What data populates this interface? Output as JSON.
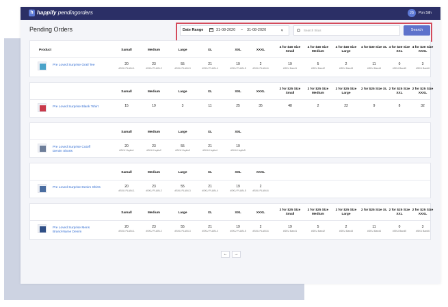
{
  "app": {
    "logo_letter": "h",
    "brand_bold": "happify",
    "brand_sub": "pendingorders"
  },
  "user": {
    "initials": "JS",
    "name": "Pon Sith"
  },
  "page_title": "Pending Orders",
  "filters": {
    "date_range_label": "Date Range",
    "date_from": "31-08-2020",
    "date_separator": "–",
    "date_to": "31-08-2020",
    "search_placeholder": "Search Skus",
    "search_button": "Search"
  },
  "products": [
    {
      "name": "Pre Loved Surprise Grail Tee",
      "thumb_color": "#4aa3c9",
      "headers": [
        "Product",
        "Samall",
        "Medium",
        "Large",
        "XL",
        "XXL",
        "XXXL",
        "4 for $40 Size Small",
        "4 for $40 Size Medium",
        "4 for $40 Size Large",
        "4 for $30 Size XL",
        "4 for $30 Size XXL",
        "4 for $30 Size XXXL"
      ],
      "cells": [
        {
          "value": "20",
          "sku": "#SKU PLAIN-1"
        },
        {
          "value": "23",
          "sku": "#SKU PLAIN-2"
        },
        {
          "value": "55",
          "sku": "#SKU PLAIN-3"
        },
        {
          "value": "21",
          "sku": "#SKU PLAIN-4"
        },
        {
          "value": "19",
          "sku": "#SKU PLAIN-5"
        },
        {
          "value": "2",
          "sku": "#SKU PLAIN-6"
        },
        {
          "value": "19",
          "sku": "#SKU Band1"
        },
        {
          "value": "5",
          "sku": "#SKU Band2"
        },
        {
          "value": "2",
          "sku": "#SKU Band3"
        },
        {
          "value": "11",
          "sku": "#SKU Band4"
        },
        {
          "value": "0",
          "sku": "#SKU Band5"
        },
        {
          "value": "3",
          "sku": "#SKU Band6"
        }
      ]
    },
    {
      "name": "Pre Loved Surprise Blank Tshirt",
      "thumb_color": "#c9394a",
      "headers": [
        "",
        "Samall",
        "Medium",
        "Large",
        "XL",
        "XXL",
        "XXXL",
        "2 for $25 Size Small",
        "2 for $25 Size Medium",
        "2 for $25 Size Large",
        "2 for $25 Size XL",
        "2 for $25 Size XXL",
        "2 for $25 Size XXXL"
      ],
      "cells": [
        {
          "value": "15",
          "sku": ""
        },
        {
          "value": "19",
          "sku": ""
        },
        {
          "value": "3",
          "sku": ""
        },
        {
          "value": "11",
          "sku": ""
        },
        {
          "value": "25",
          "sku": ""
        },
        {
          "value": "35",
          "sku": ""
        },
        {
          "value": "48",
          "sku": ""
        },
        {
          "value": "2",
          "sku": ""
        },
        {
          "value": "22",
          "sku": ""
        },
        {
          "value": "9",
          "sku": ""
        },
        {
          "value": "8",
          "sku": ""
        },
        {
          "value": "32",
          "sku": ""
        }
      ]
    },
    {
      "name": "Pre Loved Surprise Cutoff Denim Shorts",
      "thumb_color": "#6d7e99",
      "headers": [
        "",
        "Samall",
        "Medium",
        "Large",
        "XL",
        "XXL"
      ],
      "cells": [
        {
          "value": "20",
          "sku": "#SKU Hcplis1"
        },
        {
          "value": "23",
          "sku": "#SKU Hcplis2"
        },
        {
          "value": "55",
          "sku": "#SKU Hcplis3"
        },
        {
          "value": "21",
          "sku": "#SKU Hcplis4"
        },
        {
          "value": "19",
          "sku": "#SKU Hcplis5"
        }
      ]
    },
    {
      "name": "Pre Loved Surprise Denim Shirts",
      "thumb_color": "#4a6da0",
      "headers": [
        "",
        "Samall",
        "Medium",
        "Large",
        "XL",
        "XXL",
        "XXXL"
      ],
      "cells": [
        {
          "value": "20",
          "sku": "#SKU PLAIN-1"
        },
        {
          "value": "23",
          "sku": "#SKU PLAIN-2"
        },
        {
          "value": "55",
          "sku": "#SKU PLAIN-3"
        },
        {
          "value": "21",
          "sku": "#SKU PLAIN-4"
        },
        {
          "value": "19",
          "sku": "#SKU PLAIN-5"
        },
        {
          "value": "2",
          "sku": "#SKU PLAIN-6"
        }
      ]
    },
    {
      "name": "Pre Loved Surprise Mens Brand-Name Denim",
      "thumb_color": "#2f4f86",
      "headers": [
        "",
        "Samall",
        "Medium",
        "Large",
        "XL",
        "XXL",
        "XXXL",
        "2 for $25 Size Small",
        "2 for $25 Size Medium",
        "2 for $25 Size Large",
        "2 for $25 Size XL",
        "2 for $25 Size XXL",
        "2 for $25 Size XXXL"
      ],
      "cells": [
        {
          "value": "20",
          "sku": "#SKU PLAIN-1"
        },
        {
          "value": "23",
          "sku": "#SKU PLAIN-2"
        },
        {
          "value": "55",
          "sku": "#SKU PLAIN-3"
        },
        {
          "value": "21",
          "sku": "#SKU PLAIN-4"
        },
        {
          "value": "19",
          "sku": "#SKU PLAIN-5"
        },
        {
          "value": "2",
          "sku": "#SKU PLAIN-6"
        },
        {
          "value": "19",
          "sku": "#SKU Band1"
        },
        {
          "value": "5",
          "sku": "#SKU Band2"
        },
        {
          "value": "2",
          "sku": "#SKU Band3"
        },
        {
          "value": "11",
          "sku": "#SKU Band4"
        },
        {
          "value": "0",
          "sku": "#SKU Band5"
        },
        {
          "value": "3",
          "sku": "#SKU Band6"
        }
      ]
    }
  ],
  "pagination": {
    "prev": "←",
    "next": "→"
  },
  "colors": {
    "topbar": "#2b2f66",
    "accent": "#5e72cb",
    "link": "#2f6bd1",
    "highlight": "#d44b5c"
  }
}
